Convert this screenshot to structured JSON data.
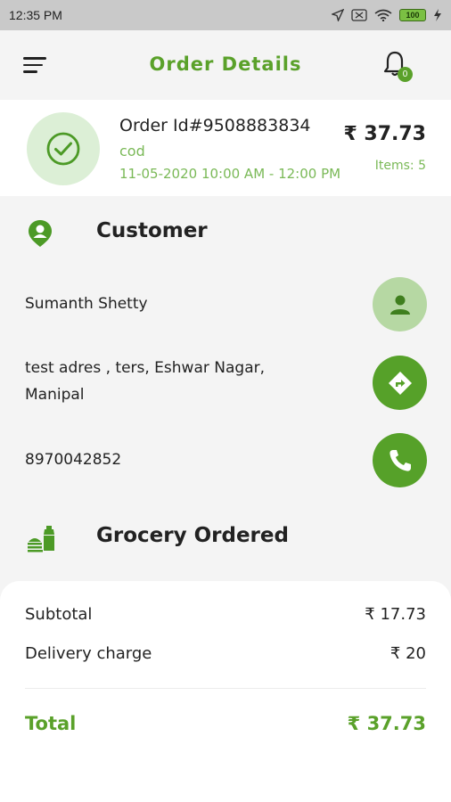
{
  "status_bar": {
    "time": "12:35 PM",
    "battery": "100"
  },
  "header": {
    "title": "Order Details",
    "notification_count": "0"
  },
  "order": {
    "id": "Order Id#9508883834",
    "payment_mode": "cod",
    "slot": "11-05-2020 10:00 AM - 12:00 PM",
    "amount": "₹ 37.73",
    "items": "Items: 5"
  },
  "customer": {
    "section_title": "Customer",
    "name": "Sumanth Shetty",
    "address_line1": "test adres , ters, Eshwar Nagar,",
    "address_line2": "Manipal",
    "phone": "8970042852"
  },
  "grocery": {
    "section_title": "Grocery Ordered"
  },
  "bill": {
    "subtotal_label": "Subtotal",
    "subtotal_value": "₹ 17.73",
    "delivery_label": "Delivery charge",
    "delivery_value": "₹ 20",
    "total_label": "Total",
    "total_value": "₹ 37.73"
  },
  "colors": {
    "accent": "#5aa12a",
    "accent_light": "#b6d8a3",
    "muted_green": "#7ab957"
  },
  "icons": [
    "menu-icon",
    "bell-icon",
    "check-icon",
    "user-pin-icon",
    "person-icon",
    "directions-icon",
    "phone-icon",
    "food-icon"
  ]
}
